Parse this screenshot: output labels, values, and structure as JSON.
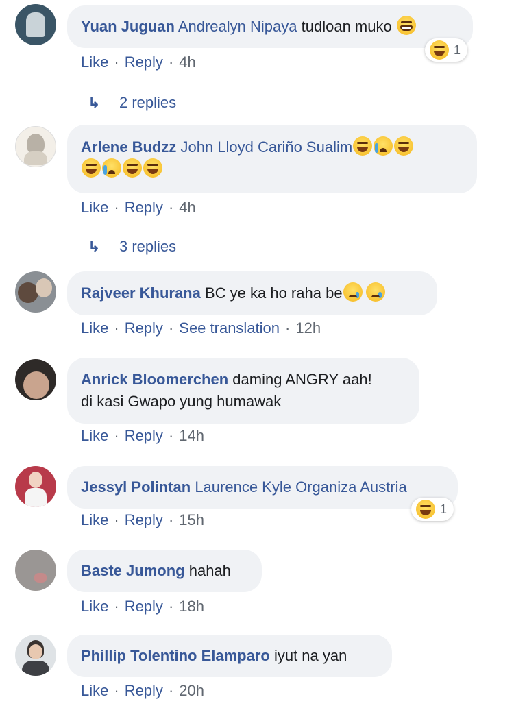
{
  "actions": {
    "like": "Like",
    "reply": "Reply",
    "see_translation": "See translation",
    "sep": "·"
  },
  "comments": [
    {
      "author": "Yuan Juguan",
      "mention": "Andrealyn Nipaya",
      "text": "tudloan muko",
      "time": "4h",
      "reaction_count": "1",
      "replies": "2 replies",
      "avatar_color": "#3a5566"
    },
    {
      "author": "Arlene Budzz",
      "mention": "John Lloyd Cariño Sualim",
      "text": "",
      "time": "4h",
      "replies": "3 replies",
      "avatar_color": "#d9d2c6"
    },
    {
      "author": "Rajveer Khurana",
      "text": "BC ye ka ho raha be",
      "time": "12h",
      "avatar_color": "#8a8f94"
    },
    {
      "author": "Anrick Bloomerchen",
      "text_line1": "daming ANGRY aah!",
      "text_line2": "di kasi Gwapo yung humawak",
      "time": "14h",
      "avatar_color": "#4a3d38"
    },
    {
      "author": "Jessyl Polintan",
      "mention": "Laurence Kyle Organiza Austria",
      "time": "15h",
      "reaction_count": "1",
      "avatar_color": "#b83a4a"
    },
    {
      "author": "Baste Jumong",
      "text": "hahah",
      "time": "18h",
      "avatar_color": "#9a9694"
    },
    {
      "author": "Phillip Tolentino Elamparo",
      "text": "iyut na yan",
      "time": "20h",
      "avatar_color": "#c8ccd0"
    }
  ]
}
